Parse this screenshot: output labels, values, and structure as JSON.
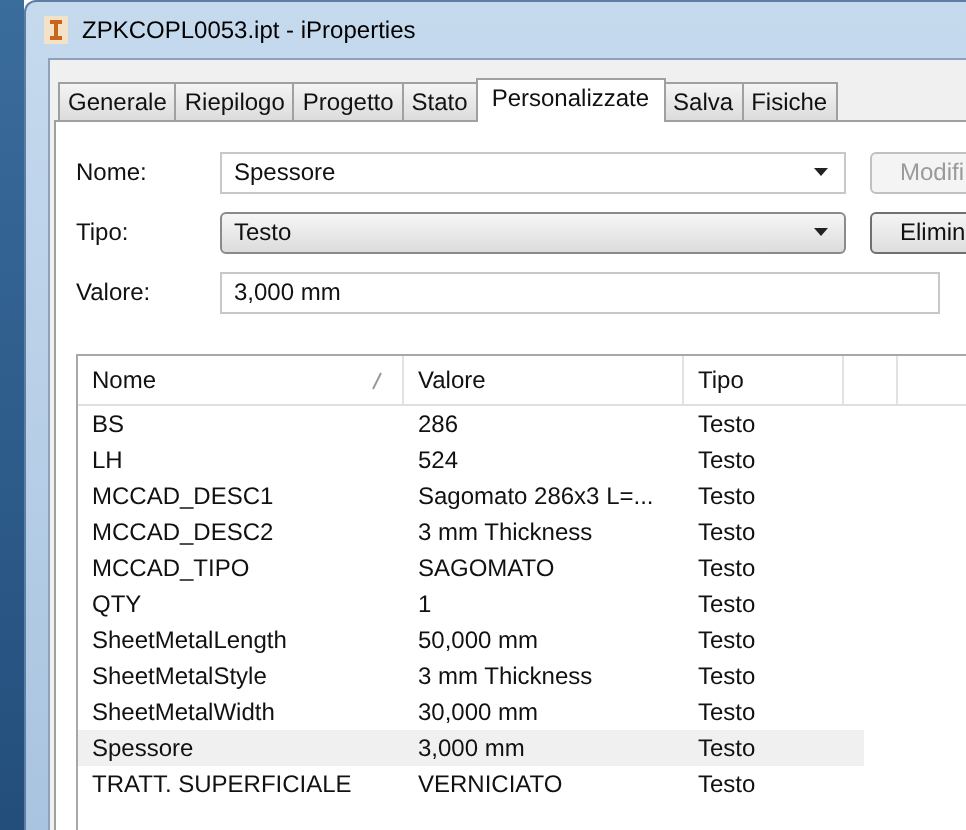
{
  "window": {
    "title": "ZPKCOPL0053.ipt - iProperties"
  },
  "tabs": [
    {
      "label": "Generale",
      "selected": false
    },
    {
      "label": "Riepilogo",
      "selected": false
    },
    {
      "label": "Progetto",
      "selected": false
    },
    {
      "label": "Stato",
      "selected": false
    },
    {
      "label": "Personalizzate",
      "selected": true
    },
    {
      "label": "Salva",
      "selected": false
    },
    {
      "label": "Fisiche",
      "selected": false
    }
  ],
  "form": [
    {
      "label": "Nome:",
      "kind": "combo",
      "value": "Spessore",
      "button": {
        "label": "Modifi",
        "disabled": true
      }
    },
    {
      "label": "Tipo:",
      "kind": "dropdown",
      "value": "Testo",
      "button": {
        "label": "Elimin",
        "disabled": false
      }
    },
    {
      "label": "Valore:",
      "kind": "text",
      "value": "3,000 mm"
    }
  ],
  "table": {
    "columns": [
      "Nome",
      "Valore",
      "Tipo"
    ],
    "rows": [
      {
        "cells": [
          "BS",
          "286",
          "Testo"
        ],
        "selected": false
      },
      {
        "cells": [
          "LH",
          "524",
          "Testo"
        ],
        "selected": false
      },
      {
        "cells": [
          "MCCAD_DESC1",
          "Sagomato 286x3 L=...",
          "Testo"
        ],
        "selected": false
      },
      {
        "cells": [
          "MCCAD_DESC2",
          "3 mm Thickness",
          "Testo"
        ],
        "selected": false
      },
      {
        "cells": [
          "MCCAD_TIPO",
          "SAGOMATO",
          "Testo"
        ],
        "selected": false
      },
      {
        "cells": [
          "QTY",
          "1",
          "Testo"
        ],
        "selected": false
      },
      {
        "cells": [
          "SheetMetalLength",
          "50,000 mm",
          "Testo"
        ],
        "selected": false
      },
      {
        "cells": [
          "SheetMetalStyle",
          "3 mm Thickness",
          "Testo"
        ],
        "selected": false
      },
      {
        "cells": [
          "SheetMetalWidth",
          "30,000 mm",
          "Testo"
        ],
        "selected": false
      },
      {
        "cells": [
          "Spessore",
          "3,000 mm",
          "Testo"
        ],
        "selected": true
      },
      {
        "cells": [
          "TRATT. SUPERFICIALE",
          "VERNICIATO",
          "Testo"
        ],
        "selected": false
      }
    ]
  }
}
